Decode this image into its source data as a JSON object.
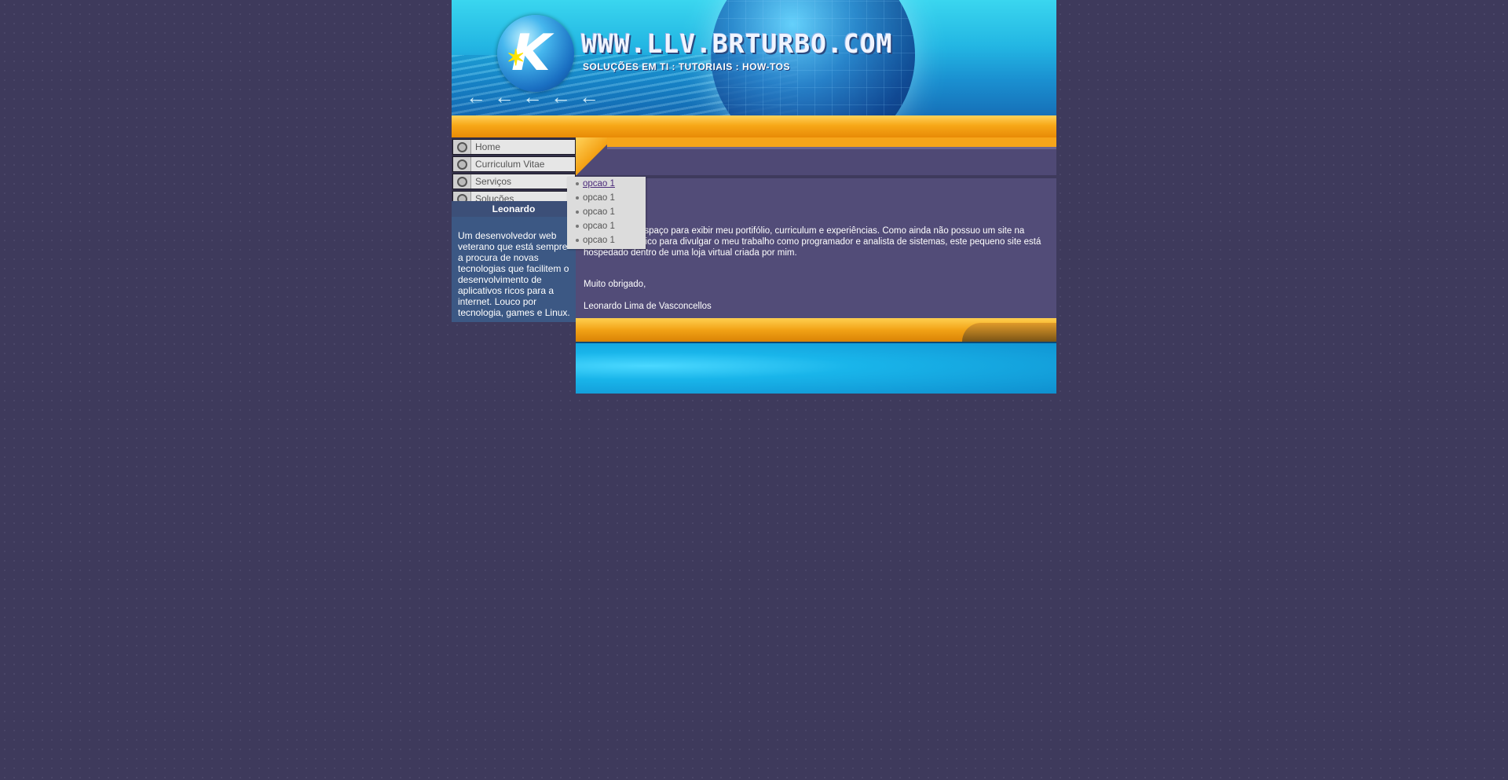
{
  "header": {
    "site_title": "WWW.LLV.BRTURBO.COM",
    "subtitle": "SOLUÇÕES EM TI : TUTORIAIS : HOW-TOS"
  },
  "menu": {
    "items": [
      {
        "label": "Home"
      },
      {
        "label": "Curriculum Vitae"
      },
      {
        "label": "Serviços"
      },
      {
        "label": "Soluções"
      }
    ]
  },
  "dropdown": {
    "items": [
      "opcao 1",
      "opcao 1",
      "opcao 1",
      "opcao 1",
      "opcao 1"
    ]
  },
  "profile": {
    "name": "Leonardo",
    "bio": "Um desenvolvedor web veterano que está sempre a procura de novas tecnologias que facilitem o desenvolvimento de aplicativos ricos para a internet. Louco por tecnologia, games e Linux."
  },
  "content": {
    "intro": "Este é o meu espaço para exibir meu portifólio, curriculum e experiências. Como ainda não possuo um site na internet específico para divulgar o meu trabalho como programador e analista de sistemas, este pequeno site está hospedado dentro de uma loja virtual criada por mim.",
    "thanks": "Muito obrigado,",
    "author": "Leonardo Lima de Vasconcellos"
  },
  "colors": {
    "background": "#3e3a5c",
    "orange": "#f7a818",
    "content_bg": "#524c78",
    "banner_blue": "#23b6e3"
  }
}
